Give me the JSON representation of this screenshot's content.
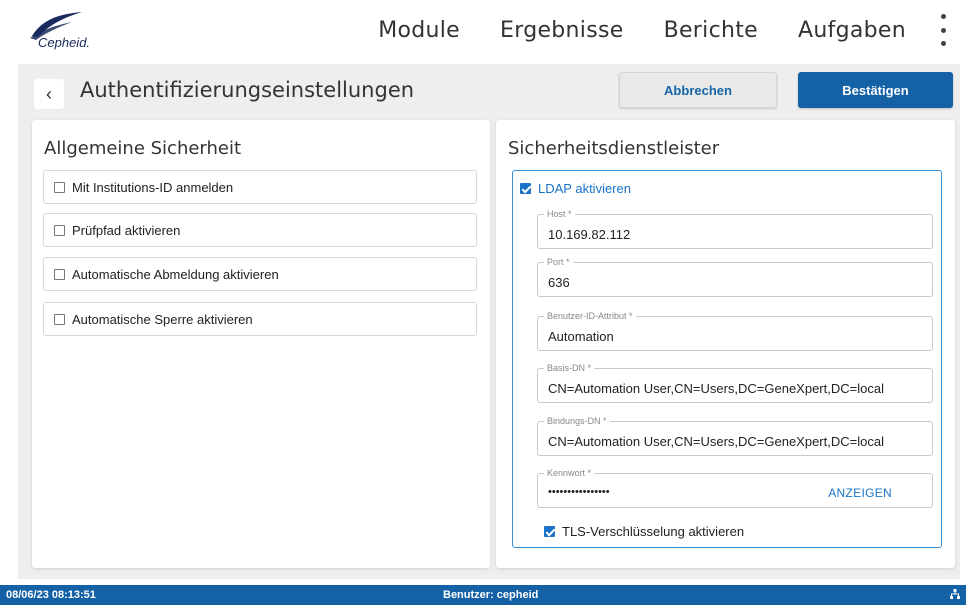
{
  "brand": {
    "logo_text": "Cepheid."
  },
  "nav": {
    "items": [
      "Module",
      "Ergebnisse",
      "Berichte",
      "Aufgaben"
    ]
  },
  "header": {
    "back_symbol": "‹",
    "title": "Authentifizierungseinstellungen",
    "cancel_label": "Abbrechen",
    "confirm_label": "Bestätigen"
  },
  "general": {
    "title": "Allgemeine Sicherheit",
    "options": [
      {
        "label": "Mit Institutions-ID anmelden",
        "checked": false
      },
      {
        "label": "Prüfpfad aktivieren",
        "checked": false
      },
      {
        "label": "Automatische Abmeldung aktivieren",
        "checked": false
      },
      {
        "label": "Automatische Sperre aktivieren",
        "checked": false
      }
    ]
  },
  "security_provider": {
    "title": "Sicherheitsdienstleister",
    "ldap_label": "LDAP aktivieren",
    "ldap_checked": true,
    "fields": [
      {
        "label": "Host *",
        "value": "10.169.82.112"
      },
      {
        "label": "Port *",
        "value": "636"
      },
      {
        "label": "Benutzer-ID-Attribut *",
        "value": "Automation"
      },
      {
        "label": "Basis-DN *",
        "value": "CN=Automation User,CN=Users,DC=GeneXpert,DC=local"
      },
      {
        "label": "Bindungs-DN *",
        "value": "CN=Automation User,CN=Users,DC=GeneXpert,DC=local"
      },
      {
        "label": "Kennwort *",
        "value": "••••••••••••••••"
      }
    ],
    "show_label": "ANZEIGEN",
    "tls_label": "TLS-Verschlüsselung aktivieren",
    "tls_checked": true
  },
  "status": {
    "datetime": "08/06/23 08:13:51",
    "user": "Benutzer: cepheid",
    "icon": "network-icon"
  },
  "colors": {
    "primary": "#1561a6",
    "link": "#1a73c8",
    "background": "#eeeeee"
  }
}
